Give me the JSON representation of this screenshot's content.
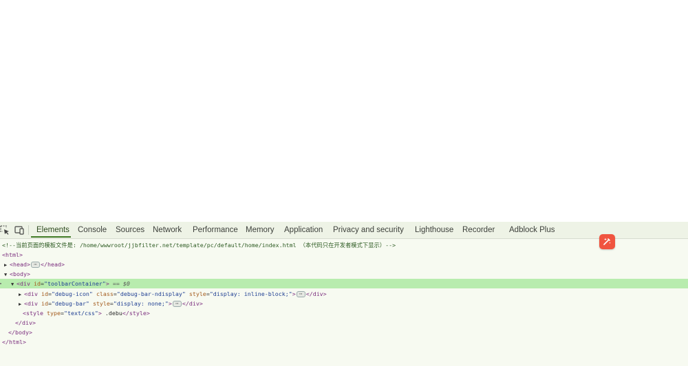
{
  "devtools": {
    "tabs": [
      {
        "label": "Elements",
        "active": true
      },
      {
        "label": "Console"
      },
      {
        "label": "Sources"
      },
      {
        "label": "Network"
      },
      {
        "label": "Performance"
      },
      {
        "label": "Memory"
      },
      {
        "label": "Application"
      },
      {
        "label": "Privacy and security"
      },
      {
        "label": "Lighthouse"
      },
      {
        "label": "Recorder"
      },
      {
        "label": "Adblock Plus"
      }
    ],
    "icons": {
      "inspect": "inspect-element-icon",
      "device": "device-toolbar-icon",
      "floating": "ai-assist-icon"
    },
    "colors": {
      "selected_row": "#b8ecae",
      "tag": "#7a2c7d",
      "attr_name": "#a35b1d",
      "attr_value": "#1f3f93",
      "comment": "#2d5b22",
      "floating_button": "#f0543f"
    }
  },
  "tree": {
    "comment": "<!--当前页面的模板文件是: /home/wwwroot/jjbfilter.net/template/pc/default/home/index.html （本代码只在开发者模式下显示）-->",
    "html_open": "<html>",
    "head_open": "<head>",
    "head_close": "</head>",
    "body_open": "<body>",
    "div_container_tag": "<div",
    "div_container_attr": "id",
    "div_container_val": "\"toolbarContainer\"",
    "div_container_end": ">",
    "dollar_zero": "== $0",
    "debug_icon_tag": "<div",
    "debug_icon_attr1": "id",
    "debug_icon_val1": "\"debug-icon\"",
    "debug_icon_attr2": "class",
    "debug_icon_val2": "\"debug-bar-ndisplay\"",
    "debug_icon_attr3": "style",
    "debug_icon_val3": "\"display: inline-block;\"",
    "debug_icon_end": ">",
    "debug_icon_close": "</div>",
    "debug_bar_tag": "<div",
    "debug_bar_attr1": "id",
    "debug_bar_val1": "\"debug-bar\"",
    "debug_bar_attr2": "style",
    "debug_bar_val2": "\"display: none;\"",
    "debug_bar_end": ">",
    "debug_bar_close": "</div>",
    "style_tag": "<style",
    "style_attr": "type",
    "style_val": "\"text/css\"",
    "style_end": ">",
    "style_text": " .debu",
    "style_close": "</style>",
    "div_close": "</div>",
    "body_close": "</body>",
    "html_close": "</html>",
    "ellipsis": "⋯"
  }
}
